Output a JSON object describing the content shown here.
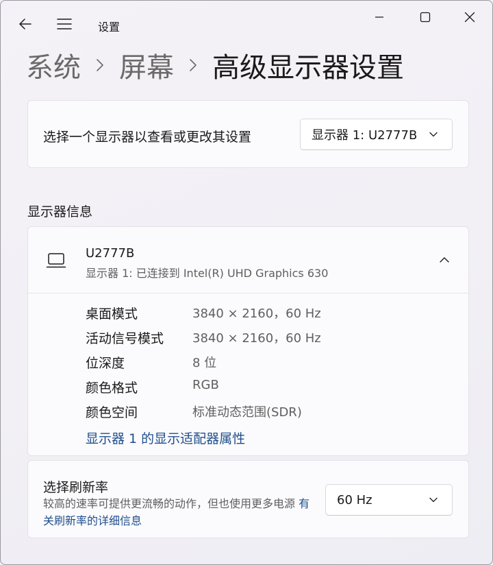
{
  "app": {
    "title": "设置"
  },
  "breadcrumb": {
    "items": [
      "系统",
      "屏幕"
    ],
    "current": "高级显示器设置"
  },
  "select_display": {
    "label": "选择一个显示器以查看或更改其设置",
    "dropdown_value": "显示器 1: U2777B"
  },
  "display_info": {
    "section_title": "显示器信息",
    "monitor_name": "U2777B",
    "monitor_subtitle": "显示器 1: 已连接到 Intel(R) UHD Graphics 630",
    "properties": [
      {
        "label": "桌面模式",
        "value": "3840 × 2160，60 Hz"
      },
      {
        "label": "活动信号模式",
        "value": "3840 × 2160，60 Hz"
      },
      {
        "label": "位深度",
        "value": "8 位"
      },
      {
        "label": "颜色格式",
        "value": "RGB"
      },
      {
        "label": "颜色空间",
        "value": "标准动态范围(SDR)"
      }
    ],
    "adapter_link": "显示器 1 的显示适配器属性"
  },
  "refresh_rate": {
    "title": "选择刷新率",
    "description": "较高的速率可提供更流畅的动作，但也使用更多电源",
    "link": "有关刷新率的详细信息",
    "dropdown_value": "60 Hz"
  }
}
